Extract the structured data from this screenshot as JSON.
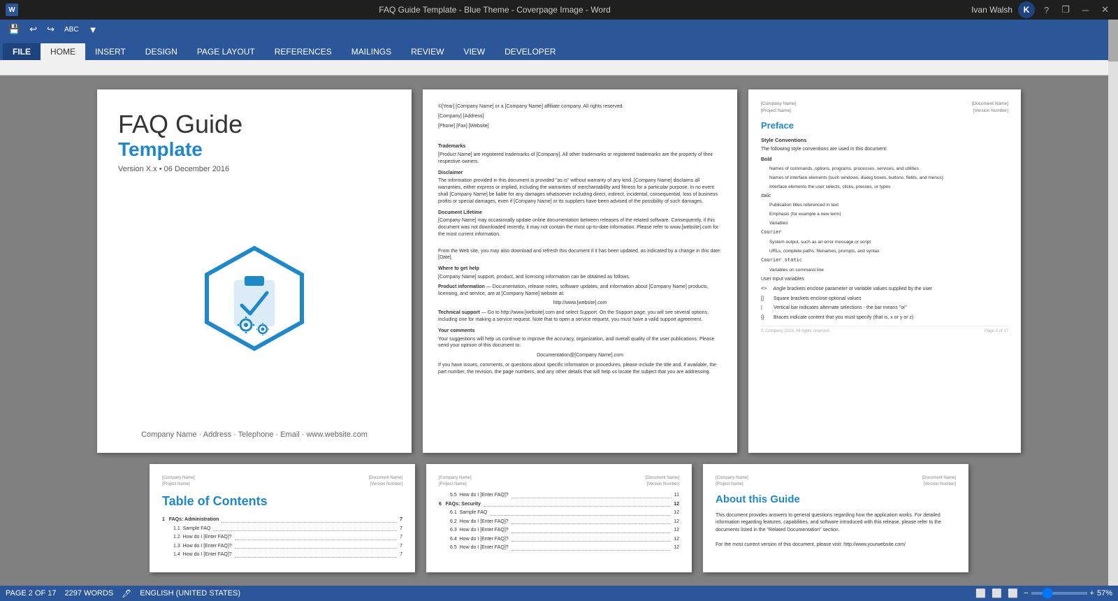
{
  "titlebar": {
    "title": "FAQ Guide Template - Blue Theme - Coverpage Image - Word",
    "user": "Ivan Walsh",
    "user_initial": "K",
    "help_btn": "?",
    "restore_btn": "❐",
    "minimize_btn": "─",
    "close_btn": "✕"
  },
  "quickaccess": {
    "save_icon": "💾",
    "undo_icon": "↩",
    "redo_icon": "↪",
    "spellcheck_icon": "ABC",
    "customize_icon": "▼"
  },
  "ribbon": {
    "tabs": [
      "FILE",
      "HOME",
      "INSERT",
      "DESIGN",
      "PAGE LAYOUT",
      "REFERENCES",
      "MAILINGS",
      "REVIEW",
      "VIEW",
      "DEVELOPER"
    ],
    "active_tab": "HOME",
    "file_tab": "FILE"
  },
  "cover": {
    "title_line1": "FAQ Guide",
    "title_line2": "Template",
    "version": "Version X.x • 06 December 2016",
    "footer": "Company Name · Address · Telephone · Email · www.website.com"
  },
  "legal": {
    "copyright": "©[Year] [Company Name] or a [Company Name] affiliate company. All rights reserved.",
    "address": "[Company] [Address]",
    "contact": "[Phone] [Fax] [Website]",
    "trademarks_title": "Trademarks",
    "trademarks_text": "[Product Name] are registered trademarks of [Company]. All other trademarks or registered trademarks are the property of their respective owners.",
    "disclaimer_title": "Disclaimer",
    "disclaimer_text": "The information provided in this document is provided \"as is\" without warranty of any kind. [Company Name] disclaims all warranties, either express or implied, including the warranties of merchantability and fitness for a particular purpose. In no event shall [Company Name] be liable for any damages whatsoever including direct, indirect, incidental, consequential, loss of business profits or special damages, even if [Company Name] or its suppliers have been advised of the possibility of such damages.",
    "lifetime_title": "Document Lifetime",
    "lifetime_text1": "[Company Name] may occasionally update online documentation between releases of the related software. Consequently, if this document was not downloaded recently, it may not contain the most up-to-date information. Please refer to www.[website].com for the most current information.",
    "lifetime_text2": "From the Web site, you may also download and refresh this document if it has been updated, as indicated by a change in this date: [Date].",
    "help_title": "Where to get help",
    "help_text": "[Company Name] support, product, and licensing information can be obtained as follows.",
    "product_title": "Product information",
    "product_text": "— Documentation, release notes, software updates, and information about [Company Name] products, licensing, and service, are at [Company Name] website at:",
    "product_url": "http://www.[website].com",
    "support_title": "Technical support",
    "support_text": "— Go to http://www.[website].com and select Support. On the Support page, you will see several options, including one for making a service request. Note that to open a service request, you must have a valid support agreement.",
    "comments_title": "Your comments",
    "comments_text": "Your suggestions will help us continue to improve the accuracy, organization, and overall quality of the user publications. Please send your opinion of this document to:",
    "comments_email": "Documentation@[Company Name].com",
    "comments_text2": "If you have issues, comments, or questions about specific information or procedures, please include the title and, if available, the part number, the revision, the page numbers, and any other details that will help us locate the subject that you are addressing."
  },
  "preface": {
    "header_left1": "[Company Name]",
    "header_left2": "[Project Name]",
    "header_right1": "[Document Name]",
    "header_right2": "[Version Number]",
    "title": "Preface",
    "style_title": "Style Conventions",
    "style_intro": "The following style conventions are used in this document:",
    "items": [
      {
        "label": "Bold",
        "desc": "Names of commands, options, programs, processes, services, and utilities"
      },
      {
        "label": "Bold",
        "desc": "Names of interface elements (such windows, dialog boxes, buttons, fields, and menus)"
      },
      {
        "label": "Bold",
        "desc": "Interface elements the user selects, clicks, presses, or types"
      },
      {
        "label": "Italic",
        "desc": "Publication titles referenced in text"
      },
      {
        "label": "Italic",
        "desc": "Emphasis (for example a new term)"
      },
      {
        "label": "Italic",
        "desc": "Variables"
      },
      {
        "label": "Courier",
        "desc": "System output, such as an error message or script"
      },
      {
        "label": "Courier",
        "desc": "URLs, complete paths, filenames, prompts, and syntax"
      },
      {
        "label": "Courier static",
        "desc": "Variables on command line"
      },
      {
        "label": "User input variables",
        "desc": ""
      },
      {
        "symbol": "<>",
        "desc": "Angle brackets enclose parameter or variable values supplied by the user"
      },
      {
        "symbol": "[]",
        "desc": "Square brackets enclose optional values"
      },
      {
        "symbol": "|",
        "desc": "Vertical bar indicates alternate selections - the bar means \"or\""
      },
      {
        "symbol": "{}",
        "desc": "Braces indicate content that you must specify (that is, x or y or z)"
      }
    ],
    "footer_left": "© Company 2016. All rights reserved.",
    "footer_right": "Page 3 of 17"
  },
  "toc": {
    "header_left1": "[Company Name]",
    "header_left2": "[Project Name]",
    "header_right1": "[Document Name]",
    "header_right2": "[Version Number]",
    "title": "Table of Contents",
    "items": [
      {
        "num": "1",
        "text": "FAQs: Administration",
        "page": "7",
        "level": 0
      },
      {
        "num": "1.1",
        "text": "Sample FAQ",
        "page": "7",
        "level": 1
      },
      {
        "num": "1.2",
        "text": "How do I [Enter FAQ]?",
        "page": "7",
        "level": 1
      },
      {
        "num": "1.3",
        "text": "How do I [Enter FAQ]?",
        "page": "7",
        "level": 1
      },
      {
        "num": "1.4",
        "text": "How do I [Enter FAQ]?",
        "page": "7",
        "level": 1
      }
    ]
  },
  "faq_security": {
    "header_left1": "[Company Name]",
    "header_left2": "[Project Name]",
    "header_right1": "[Document Name]",
    "header_right2": "[Version Number]",
    "items": [
      {
        "num": "5.5",
        "text": "How do I [Enter FAQ]?",
        "page": "11"
      },
      {
        "num": "6",
        "text": "FAQs: Security",
        "page": "12",
        "main": true
      },
      {
        "num": "6.1",
        "text": "Sample FAQ",
        "page": "12"
      },
      {
        "num": "6.2",
        "text": "How do I [Enter FAQ]?",
        "page": "12"
      },
      {
        "num": "6.3",
        "text": "How do I [Enter FAQ]?",
        "page": "12"
      },
      {
        "num": "6.4",
        "text": "How do I [Enter FAQ]?",
        "page": "12"
      },
      {
        "num": "6.5",
        "text": "How do I [Enter FAQ]?",
        "page": "12"
      }
    ]
  },
  "about": {
    "header_left1": "[Company Name]",
    "header_left2": "[Project Name]",
    "header_right1": "[Document Name]",
    "header_right2": "[Version Number]",
    "title": "About this Guide",
    "text1": "This document provides answers to general questions regarding how the application works. For detailed information regarding features, capabilities, and software introduced with this release, please refer to the documents listed in the \"Related Documentation\" section.",
    "text2": "For the most current version of this document, please visit: http://www.yourwebsite.com/"
  },
  "statusbar": {
    "page_info": "PAGE 2 OF 17",
    "word_count": "2297 WORDS",
    "track_changes": "🖊",
    "language": "ENGLISH (UNITED STATES)",
    "zoom_level": "57%",
    "view_icons": [
      "⬜",
      "⬜",
      "⬜"
    ]
  }
}
